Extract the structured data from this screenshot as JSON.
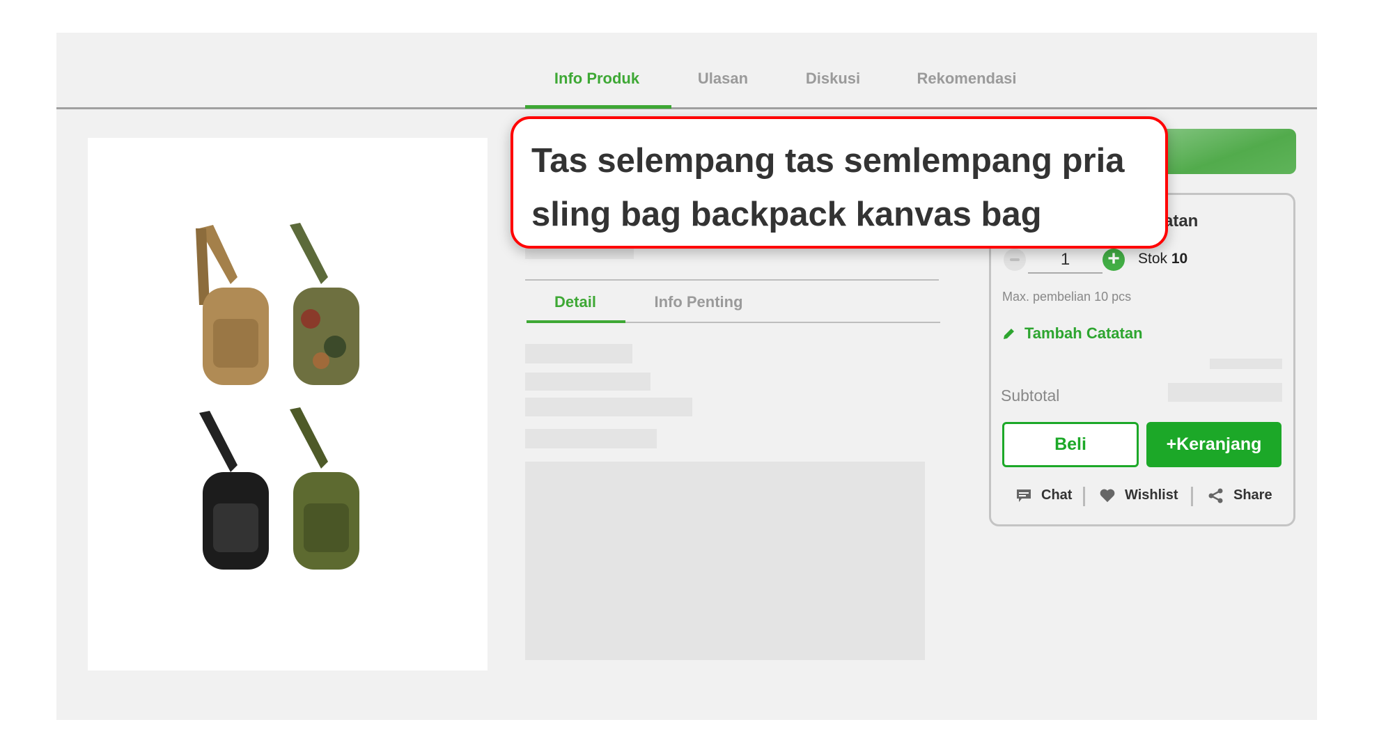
{
  "tabs": [
    {
      "label": "Info Produk",
      "active": true
    },
    {
      "label": "Ulasan"
    },
    {
      "label": "Diskusi"
    },
    {
      "label": "Rekomendasi"
    }
  ],
  "subtabs": [
    {
      "label": "Detail",
      "active": true
    },
    {
      "label": "Info Penting"
    }
  ],
  "popup": {
    "title": "Tas selempang tas semlempang pria sling bag backpack kanvas bag"
  },
  "card": {
    "heading_fragment": "tatan",
    "quantity": "1",
    "stock_label": "Stok",
    "stock_value": "10",
    "max_note": "Max. pembelian 10 pcs",
    "add_note": "Tambah Catatan",
    "subtotal_label": "Subtotal",
    "buy_label": "Beli",
    "cart_label": "+Keranjang",
    "actions": {
      "chat": "Chat",
      "wishlist": "Wishlist",
      "share": "Share"
    }
  },
  "colors": {
    "accent": "#1ca828",
    "highlight_border": "#ff0000",
    "background": "#f1f1f1"
  }
}
